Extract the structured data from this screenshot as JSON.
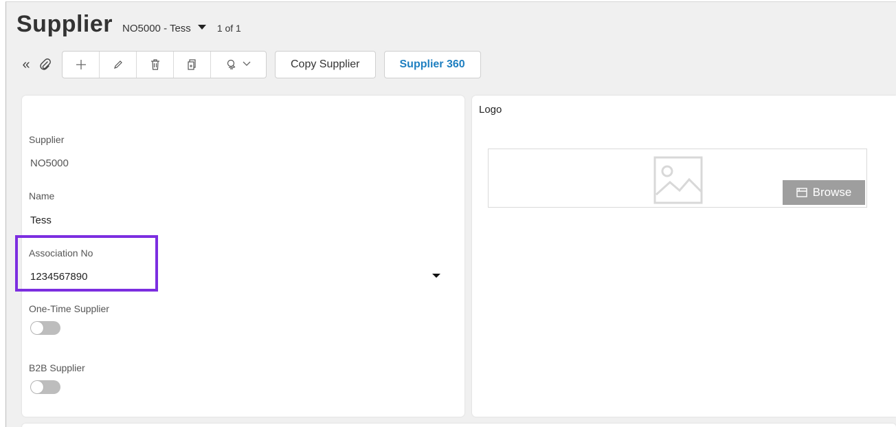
{
  "header": {
    "title": "Supplier",
    "record": "NO5000 - Tess",
    "count": "1 of 1"
  },
  "toolbar": {
    "collapse_icon": "«",
    "attach_icon": "paperclip-icon",
    "group_icons": [
      "plus-icon",
      "pencil-icon",
      "trash-icon",
      "duplicate-icon",
      "alert-icon"
    ],
    "copy_supplier_label": "Copy Supplier",
    "supplier_360_label": "Supplier 360"
  },
  "form": {
    "supplier_label": "Supplier",
    "supplier_value": "NO5000",
    "name_label": "Name",
    "name_value": "Tess",
    "association_label": "Association No",
    "association_value": "1234567890",
    "one_time_label": "One-Time Supplier",
    "one_time_value": false,
    "b2b_label": "B2B Supplier",
    "b2b_value": false
  },
  "logo": {
    "label": "Logo",
    "browse_label": "Browse"
  },
  "colors": {
    "accent_link": "#1e7fc0",
    "highlight": "#7c2ee0",
    "browse_bg": "#9e9e9e"
  }
}
